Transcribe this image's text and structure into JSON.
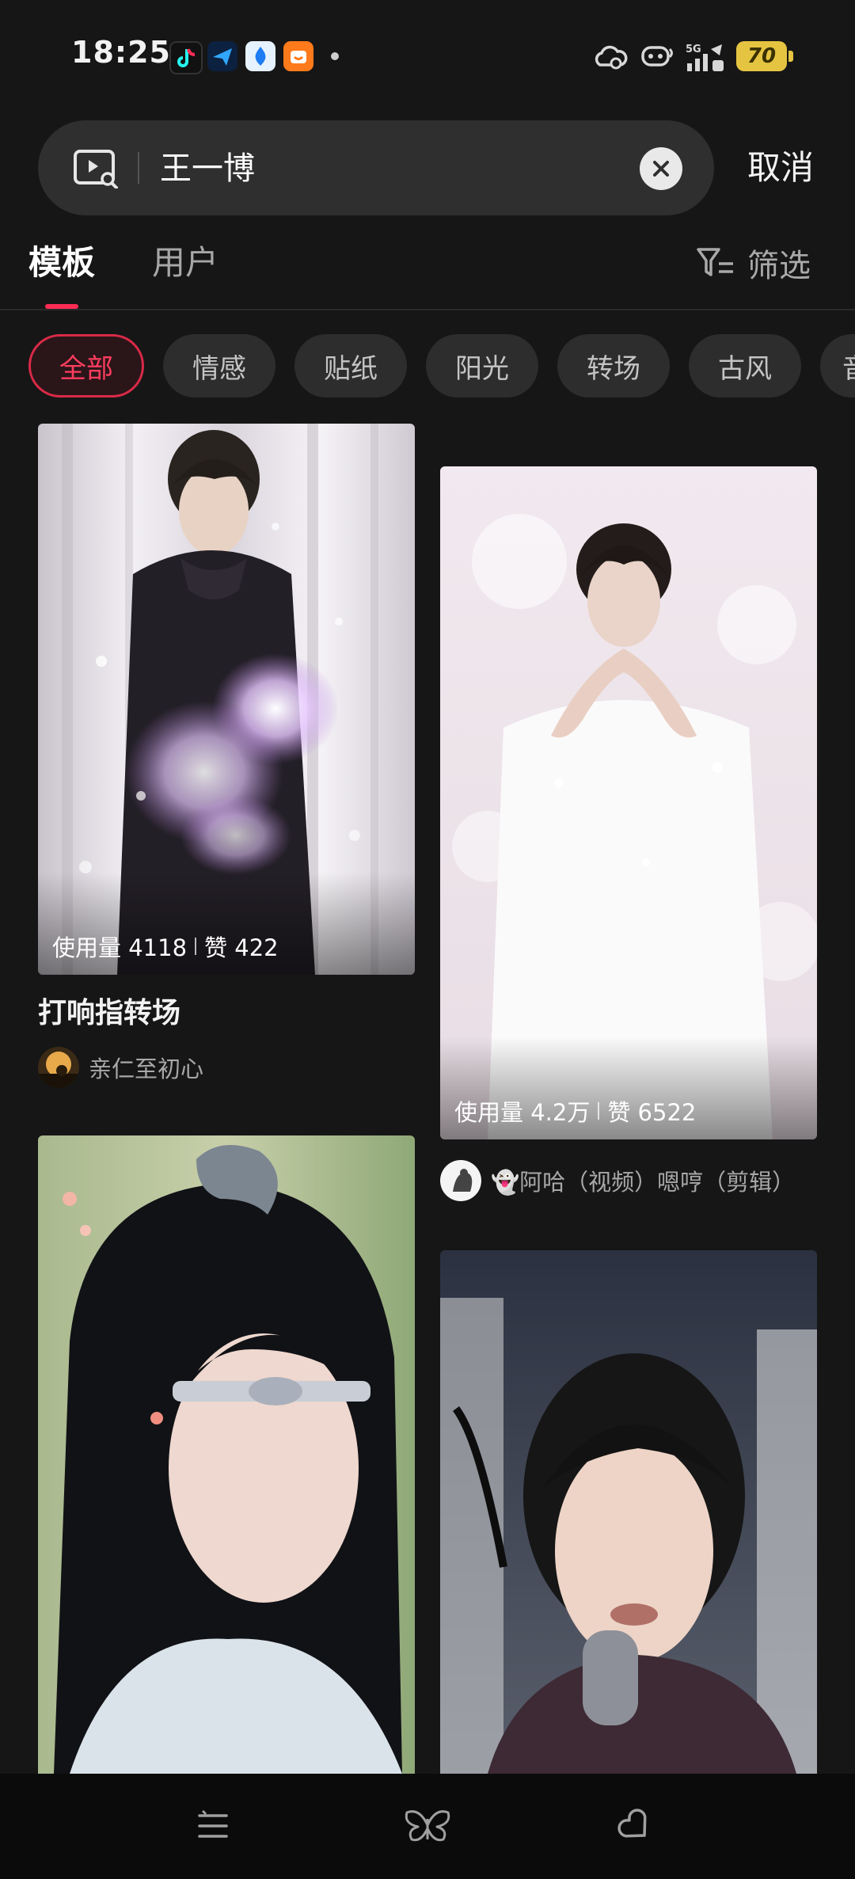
{
  "status_bar": {
    "time": "18:25",
    "app_icons": [
      "tiktok-icon",
      "paper-plane-app-icon",
      "blue-drop-app-icon",
      "orange-app-icon"
    ],
    "right_icons": [
      "cloud-status-icon",
      "bot-status-icon",
      "5g-signal-icon",
      "data-speed-icon"
    ],
    "battery_level": "70",
    "battery_color": "#e5c441"
  },
  "search": {
    "query": "王一博",
    "cancel_label": "取消"
  },
  "tabs": {
    "items": [
      {
        "label": "模板",
        "active": true
      },
      {
        "label": "用户",
        "active": false
      }
    ],
    "filter_label": "筛选",
    "accent_color": "#fe2c55"
  },
  "chips": [
    "全部",
    "情感",
    "贴纸",
    "阳光",
    "转场",
    "古风",
    "音"
  ],
  "cards": [
    {
      "stats_usage": "使用量 4118",
      "stats_likes": "赞 422",
      "title": "打响指转场",
      "author": "亲仁至初心"
    },
    {
      "stats_usage": "使用量 4.2万",
      "stats_likes": "赞 6522",
      "title": "",
      "author": "👻阿哈（视频）嗯哼（剪辑）"
    },
    {
      "stats_usage": "",
      "stats_likes": "",
      "title": "",
      "author": ""
    },
    {
      "stats_usage": "",
      "stats_likes": "",
      "title": "",
      "author": ""
    }
  ],
  "bottom_nav": [
    "list-icon",
    "butterfly-icon",
    "heart-outline-icon"
  ]
}
